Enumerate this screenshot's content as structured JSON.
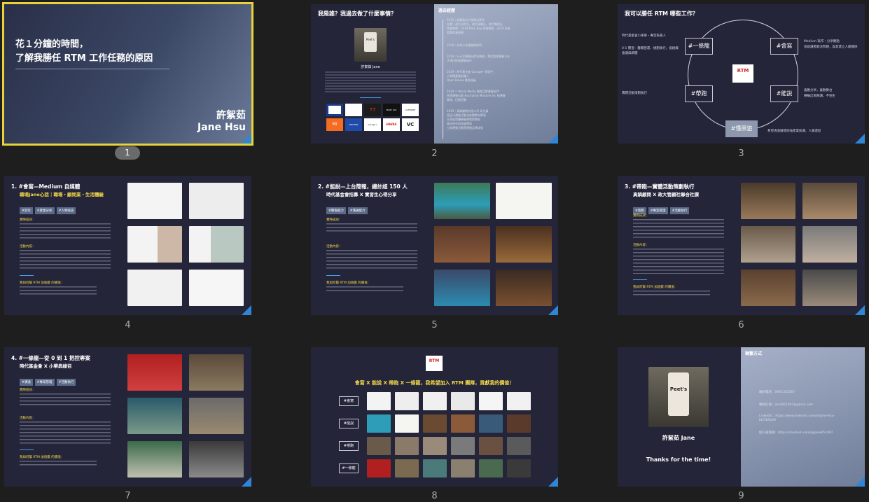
{
  "slides": [
    {
      "number": "1",
      "title_line1": "花１分鐘的時間，",
      "title_line2": "了解我勝任 RTM 工作任務的原因",
      "name_cn": "許絮茹",
      "name_en": "Jane Hsu"
    },
    {
      "number": "2",
      "title": "我是誰？我過去做了什麼事情？",
      "panel_title": "過去經歷",
      "person_name": "許絮茹 Jane",
      "cup_brand": "Peet's",
      "timeline": [
        "2015｜就讀政治大學政治學系\n社團：政大研究社、政大演劃社、熱門舞蹈社\n商業競賽：2018 Mary Kay 商業競賽、2019 安泰\n相關商業競賽",
        "2018｜台灣小米運營商部門",
        "2018｜行天宮運營社群宣傳組，專案管理運營主任\n子項目經營運營執行",
        "2019｜時代基金會 Garage+ 實習生\n小果實產業創業人\nOpen House 專案成員",
        "2019｜I-Novia Media 國際品牌運營部門\n負責運營出版 Australian Moozine Inc 線運營\n事長、行銷活動",
        "2019｜真鍋顧問有限公司 研究員\n西班牙運營活動及新聞素材撰寫\n天然氣暨體驗營運環節撰寫\n政治研究與發展撰寫\n工具運營活動暨運營品牌成效"
      ],
      "logos": [
        "XM",
        "FGH",
        "77",
        "MARY KAY",
        "LIVEWIRE",
        "Mi",
        "NIELSEN",
        "Garage+",
        "HAVAS",
        "VC"
      ]
    },
    {
      "number": "3",
      "title": "我可以勝任 RTM 哪些工作？",
      "boxes": [
        "#一條龍",
        "#會寫",
        "#帶跑",
        "#能說",
        "#懂原遊"
      ],
      "left_notes": [
        "時代基金會小果果・專案負責人",
        "0-1 實習：籌備營運、規劃執行，協組織會議與網團",
        "實踐活動策劃執行"
      ],
      "right_notes": [
        "Medium 寫作・分享觀點",
        "協助讀者解決問題，與其建立人脈關係",
        "喜歡分享，喜歡舞台",
        "樂輪出風險讀，不怕生",
        "希望透過展開加強產業知識、人脈連結"
      ],
      "center_logo": "RTM"
    },
    {
      "number": "4",
      "heading": "1. #會寫—Medium 自媒體",
      "subheading": "職場Jane心話｜職場・顧問業・生活體驗",
      "tags": [
        "#寫作",
        "#產業分析",
        "#人物採訪"
      ],
      "sections": [
        "實際成效：",
        "活動內容：",
        "我如何幫 RTM 加值變 的價值："
      ]
    },
    {
      "number": "5",
      "heading": "2. #能說—上台簡報，總計超 150 人",
      "subheading": "時代基金會招募 X 實習生心得分享",
      "tags": [
        "#簡報能力",
        "#溝通能力"
      ],
      "sections": [
        "實際成效：",
        "活動內容：",
        "我如何幫 RTM 加值變 的價值："
      ]
    },
    {
      "number": "6",
      "heading": "3. #帶跑—實體活動策劃執行",
      "subheading": "真鍋顧問 X 政大管顧社聯合社課",
      "tags": [
        "#策劃",
        "#專案管理",
        "#活動執行"
      ],
      "sections": [
        "實際成效：",
        "活動內容：",
        "我如何幫 RTM 加值變 的價值："
      ]
    },
    {
      "number": "7",
      "heading": "4. #一條龍—從 0 到 1 把控專案",
      "subheading": "時代基金會 X 小華典綠召",
      "tags": [
        "#溝通",
        "#專案管理",
        "#活動執行"
      ],
      "sections": [
        "實際成效：",
        "活動內容：",
        "我如何幫 RTM 加值變 的價值："
      ]
    },
    {
      "number": "8",
      "logo": "RTM",
      "title": "會寫 X 能說 X 帶跑 X 一條龍，我希望加入 RTM 團隊，貢獻我的價值！",
      "row_labels": [
        "#會寫",
        "#能說",
        "#帶跑",
        "#一條龍"
      ]
    },
    {
      "number": "9",
      "person_name": "許絮茹 Jane",
      "cup_brand": "Peet's",
      "thanks": "Thanks for the time!",
      "panel_title": "聯繫方式",
      "contacts": [
        "聯絡電話：0901302567",
        "聯絡信箱：jane851007@gmail.com",
        "LinkedIn：https://www.linkedin.com/in/jane-hsu-bb7420a9/",
        "個人部落格：https://medium.com/@jane851007"
      ]
    }
  ],
  "colors": {
    "selected_outline": "#e8d23a",
    "slide_bg": "#25253a",
    "accent_blue": "#2f86d6",
    "highlight_yellow": "#f1d94a"
  }
}
